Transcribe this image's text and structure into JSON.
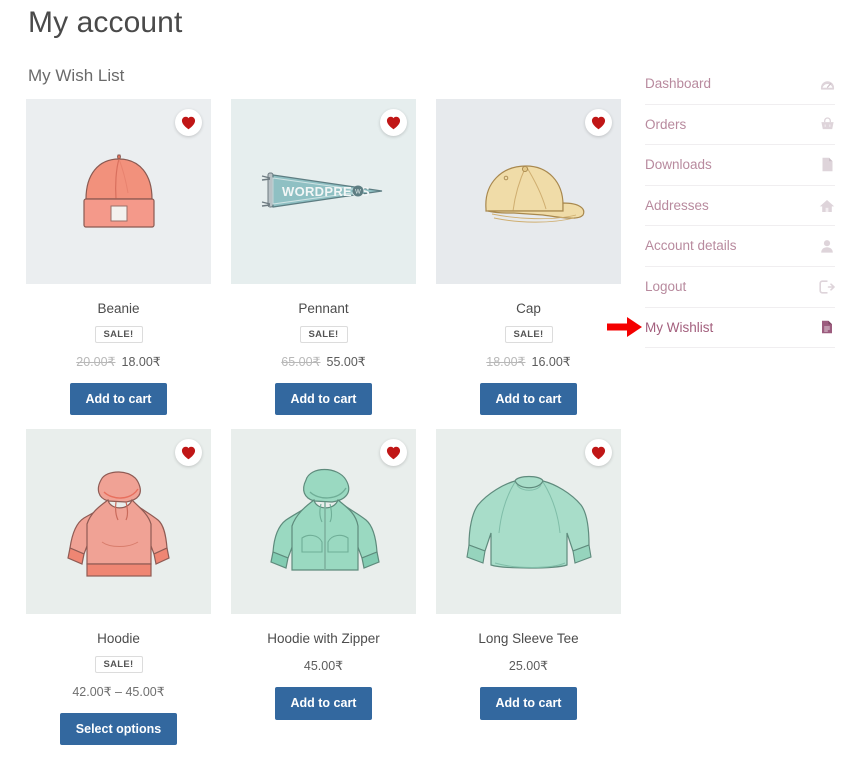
{
  "page": {
    "title": "My account",
    "section_title": "My Wish List"
  },
  "products": [
    {
      "name": "Beanie",
      "sale_label": "SALE!",
      "on_sale": true,
      "price_old": "20.00₹",
      "price_new": "18.00₹",
      "button_label": "Add to cart",
      "wishlist_icon": "heart-icon",
      "image_icon": "beanie-image",
      "image_color": "#f2917c",
      "thumb_bg": "#ebeef0"
    },
    {
      "name": "Pennant",
      "sale_label": "SALE!",
      "on_sale": true,
      "price_old": "65.00₹",
      "price_new": "55.00₹",
      "button_label": "Add to cart",
      "wishlist_icon": "heart-icon",
      "image_icon": "pennant-image",
      "image_color": "#8fc0c3",
      "thumb_bg": "#e6eeee"
    },
    {
      "name": "Cap",
      "sale_label": "SALE!",
      "on_sale": true,
      "price_old": "18.00₹",
      "price_new": "16.00₹",
      "button_label": "Add to cart",
      "wishlist_icon": "heart-icon",
      "image_icon": "cap-image",
      "image_color": "#f0dca8",
      "thumb_bg": "#e7eaed"
    },
    {
      "name": "Hoodie",
      "sale_label": "SALE!",
      "on_sale": true,
      "price_old": "",
      "price_new": "",
      "price_range": "42.00₹ – 45.00₹",
      "button_label": "Select options",
      "wishlist_icon": "heart-icon",
      "image_icon": "hoodie-image",
      "image_color": "#f0a295",
      "thumb_bg": "#e9eeec"
    },
    {
      "name": "Hoodie with Zipper",
      "sale_label": "",
      "on_sale": false,
      "price_old": "",
      "price_new": "45.00₹",
      "button_label": "Add to cart",
      "wishlist_icon": "heart-icon",
      "image_icon": "hoodie-zipper-image",
      "image_color": "#9ad9c1",
      "thumb_bg": "#e9eeec"
    },
    {
      "name": "Long Sleeve Tee",
      "sale_label": "",
      "on_sale": false,
      "price_old": "",
      "price_new": "25.00₹",
      "button_label": "Add to cart",
      "wishlist_icon": "heart-icon",
      "image_icon": "long-sleeve-tee-image",
      "image_color": "#a8ddc9",
      "thumb_bg": "#e9eeec"
    }
  ],
  "sidebar": {
    "items": [
      {
        "label": "Dashboard",
        "icon": "dashboard-icon",
        "active": false
      },
      {
        "label": "Orders",
        "icon": "basket-icon",
        "active": false
      },
      {
        "label": "Downloads",
        "icon": "file-icon",
        "active": false
      },
      {
        "label": "Addresses",
        "icon": "home-icon",
        "active": false
      },
      {
        "label": "Account details",
        "icon": "person-icon",
        "active": false
      },
      {
        "label": "Logout",
        "icon": "logout-icon",
        "active": false
      },
      {
        "label": "My Wishlist",
        "icon": "wishlist-icon",
        "active": true
      }
    ]
  },
  "annotation": {
    "arrow": "red-arrow-pointer",
    "points_to": "My Wishlist"
  },
  "colors": {
    "button": "#33689f",
    "nav_text": "#b88a9e",
    "nav_active_text": "#a35f7d",
    "heart": "#c01616",
    "arrow": "#f40000",
    "title": "#4a4a4a"
  }
}
